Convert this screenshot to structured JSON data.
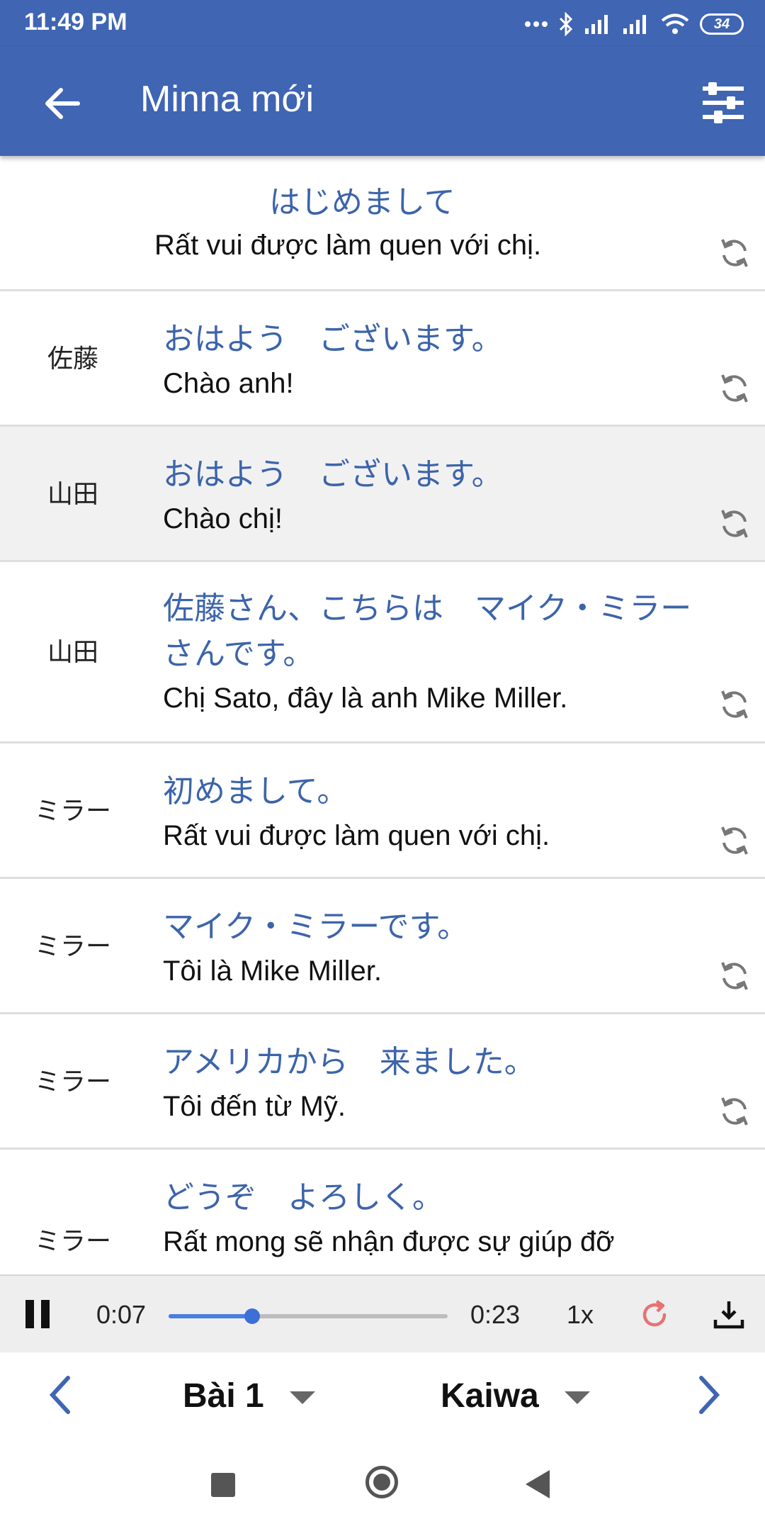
{
  "status_bar": {
    "time": "11:49 PM",
    "battery": "34"
  },
  "app_bar": {
    "title": "Minna mới"
  },
  "dialogue": [
    {
      "speaker": "",
      "jp": "はじめまして",
      "vi": "Rất vui được làm quen với chị."
    },
    {
      "speaker": "佐藤",
      "jp": "おはよう　ございます。",
      "vi": "Chào anh!"
    },
    {
      "speaker": "山田",
      "jp": "おはよう　ございます。",
      "vi": "Chào chị!"
    },
    {
      "speaker": "山田",
      "jp_line1": "佐藤さん、こちらは　マイク・ミラー",
      "jp_line2": "さんです。",
      "vi": "Chị Sato, đây là anh Mike Miller."
    },
    {
      "speaker": "ミラー",
      "jp": "初めまして。",
      "vi": "Rất vui được làm quen với chị."
    },
    {
      "speaker": "ミラー",
      "jp": "マイク・ミラーです。",
      "vi": "Tôi là Mike Miller."
    },
    {
      "speaker": "ミラー",
      "jp": "アメリカから　来ました。",
      "vi": "Tôi đến từ Mỹ."
    },
    {
      "speaker": "ミラー",
      "jp": "どうぞ　よろしく。",
      "vi": "Rất mong sẽ nhận được sự giúp đỡ"
    }
  ],
  "player": {
    "current_time": "0:07",
    "duration": "0:23",
    "progress": 0.3,
    "speed": "1x"
  },
  "lesson_nav": {
    "lesson": "Bài 1",
    "section": "Kaiwa"
  },
  "colors": {
    "primary": "#3f65b3",
    "japanese_text": "#3c64aa",
    "replay_icon": "#e57373",
    "seek": "#4a7de0"
  }
}
